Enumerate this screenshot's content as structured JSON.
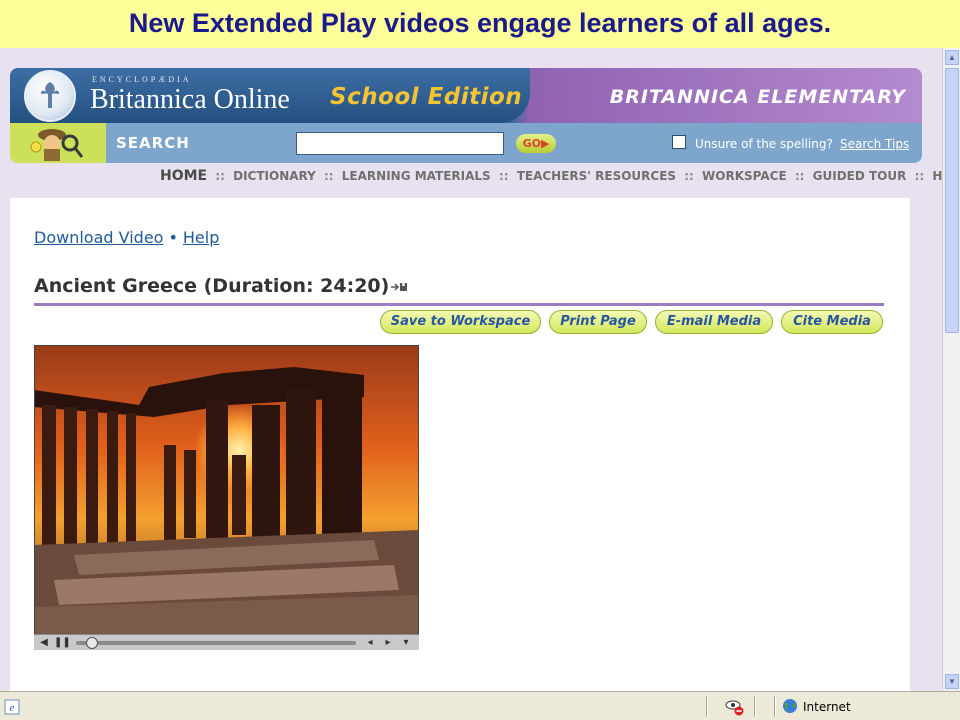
{
  "slide": {
    "caption": "New Extended Play videos engage learners of all ages."
  },
  "header": {
    "brand_small": "ENCYCLOPÆDIA",
    "brand_main": "Britannica Online",
    "brand_edition": "School Edition",
    "brand_right": "BRITANNICA ELEMENTARY"
  },
  "search": {
    "label": "SEARCH",
    "input_value": "",
    "go_label": "GO▶",
    "spelling_label": "Unsure of the spelling?",
    "spelling_checked": false,
    "tips_label": "Search Tips"
  },
  "nav": {
    "items": [
      "HOME",
      "DICTIONARY",
      "LEARNING MATERIALS",
      "TEACHERS' RESOURCES",
      "WORKSPACE",
      "GUIDED TOUR",
      "HELP"
    ],
    "separator": "::"
  },
  "content": {
    "download_link": "Download Video",
    "link_separator": "•",
    "help_link": "Help",
    "title": "Ancient Greece (Duration: 24:20)",
    "actions": [
      "Save to Workspace",
      "Print Page",
      "E-mail Media",
      "Cite Media"
    ]
  },
  "statusbar": {
    "zone": "Internet"
  }
}
